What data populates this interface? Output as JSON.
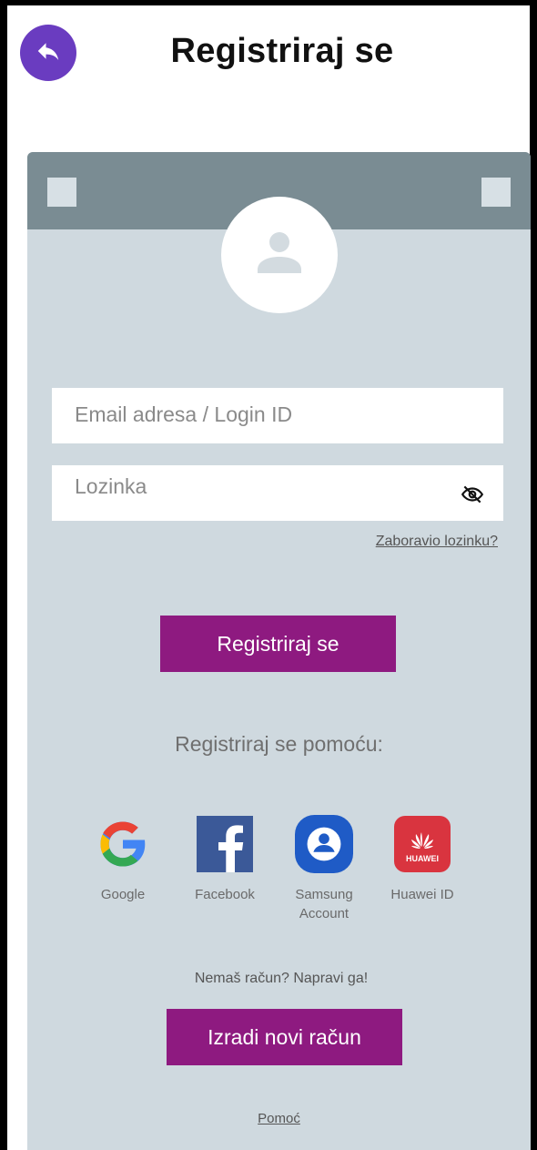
{
  "header": {
    "title": "Registriraj se",
    "back_icon": "reply-arrow-icon",
    "back_color": "#6a3cc0"
  },
  "form": {
    "email_placeholder": "Email adresa / Login ID",
    "password_placeholder": "Lozinka",
    "password_toggle_icon": "eye-off-icon",
    "forgot_password": "Zaboravio lozinku?",
    "submit_label": "Registriraj se"
  },
  "social": {
    "title": "Registriraj se pomoću:",
    "providers": [
      {
        "label": "Google",
        "icon": "google-icon"
      },
      {
        "label": "Facebook",
        "icon": "facebook-icon"
      },
      {
        "label": "Samsung Account",
        "icon": "samsung-account-icon"
      },
      {
        "label": "Huawei ID",
        "icon": "huawei-icon"
      }
    ]
  },
  "signup": {
    "prompt": "Nemaš račun? Napravi ga!",
    "button_label": "Izradi novi račun"
  },
  "footer": {
    "help": "Pomoć"
  },
  "colors": {
    "accent": "#8e1a80",
    "card_bg": "#cfd9df",
    "card_header": "#7a8c93"
  }
}
